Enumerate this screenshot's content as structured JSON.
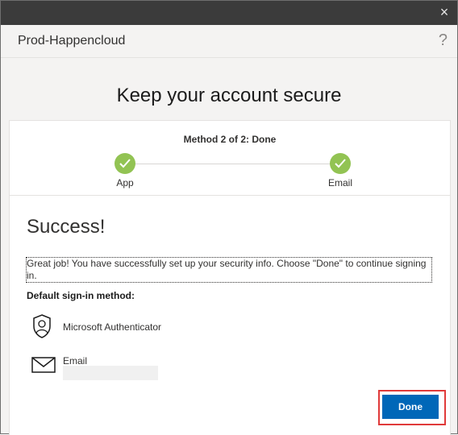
{
  "window": {
    "close_glyph": "×"
  },
  "header": {
    "org_name": "Prod-Happencloud",
    "help_glyph": "?"
  },
  "page": {
    "title": "Keep your account secure"
  },
  "progress": {
    "method_text": "Method 2 of 2: Done",
    "steps": [
      {
        "label": "App",
        "status": "complete"
      },
      {
        "label": "Email",
        "status": "complete"
      }
    ]
  },
  "content": {
    "success_heading": "Success!",
    "message": "Great job! You have successfully set up your security info. Choose \"Done\" to continue signing in.",
    "default_label": "Default sign-in method:",
    "methods": [
      {
        "icon": "authenticator-icon",
        "name": "Microsoft Authenticator"
      },
      {
        "icon": "mail-icon",
        "name": "Email"
      }
    ]
  },
  "actions": {
    "done_label": "Done"
  },
  "colors": {
    "accent": "#0067b8",
    "success": "#92c353",
    "highlight": "#e03a3a"
  }
}
